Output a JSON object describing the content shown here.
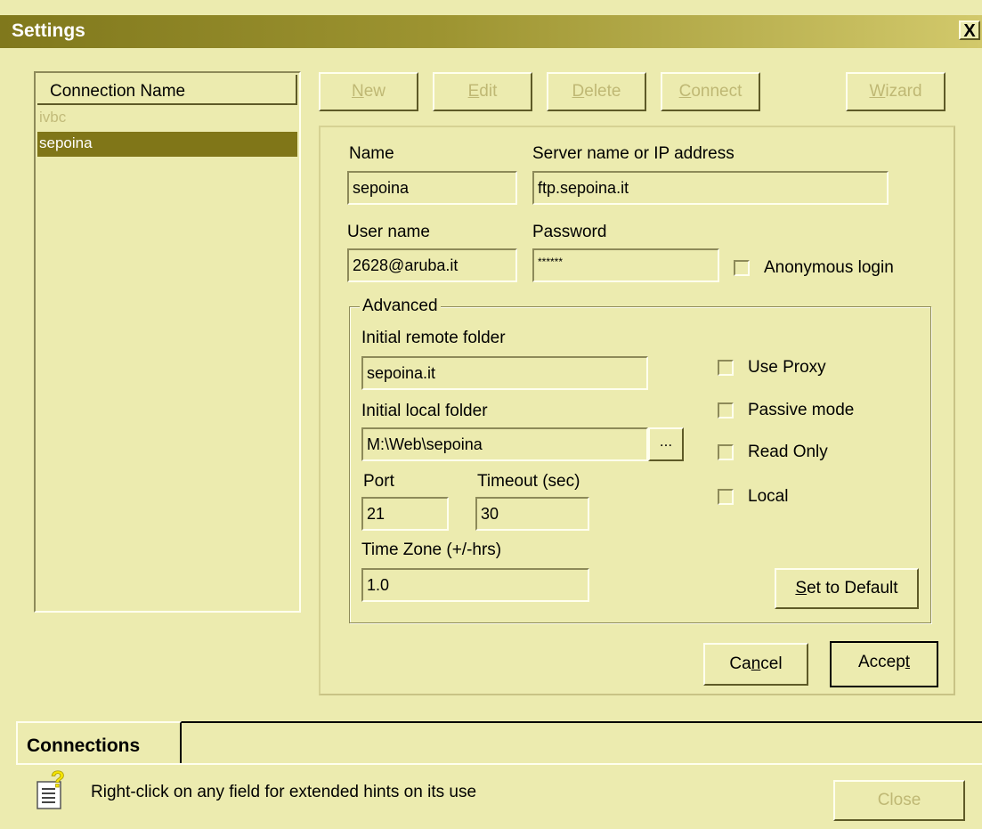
{
  "window": {
    "title": "Settings",
    "close_glyph": "X"
  },
  "connections_list": {
    "header": "Connection Name",
    "items": [
      {
        "label": "ivbc",
        "state": "disabled"
      },
      {
        "label": "sepoina",
        "state": "selected"
      }
    ]
  },
  "toolbar": {
    "new_label": "New",
    "new_mnemonic": "N",
    "new_rest": "ew",
    "edit_label": "Edit",
    "edit_mnemonic": "E",
    "edit_rest": "dit",
    "delete_label": "Delete",
    "delete_mnemonic": "D",
    "delete_rest": "elete",
    "connect_label": "Connect",
    "connect_mnemonic": "C",
    "connect_rest": "onnect",
    "wizard_label": "Wizard",
    "wizard_mnemonic": "W",
    "wizard_rest": "izard"
  },
  "form": {
    "name_label": "Name",
    "name_value": "sepoina",
    "server_label": "Server name or IP address",
    "server_value": "ftp.sepoina.it",
    "user_label": "User name",
    "user_value": "2628@aruba.it",
    "password_label": "Password",
    "password_value": "******",
    "anonymous_label": "Anonymous login"
  },
  "advanced": {
    "group_label": "Advanced",
    "remote_folder_label": "Initial remote folder",
    "remote_folder_value": "sepoina.it",
    "local_folder_label": "Initial local folder",
    "local_folder_value": "M:\\Web\\sepoina",
    "browse_label": "...",
    "port_label": "Port",
    "port_value": "21",
    "timeout_label": "Timeout (sec)",
    "timeout_value": "30",
    "timezone_label": "Time Zone (+/-hrs)",
    "timezone_value": "1.0",
    "use_proxy_label": "Use Proxy",
    "passive_mode_label": "Passive mode",
    "read_only_label": "Read Only",
    "local_label": "Local",
    "set_default_mnemonic": "S",
    "set_default_rest": "et to Default"
  },
  "actions": {
    "cancel_pre": "Ca",
    "cancel_mnemonic": "n",
    "cancel_post": "cel",
    "accept_pre": "Accep",
    "accept_mnemonic": "t",
    "accept_post": ""
  },
  "footer": {
    "tab_label": "Connections",
    "hint_text": "Right-click on any field for extended hints on its use",
    "close_label": "Close"
  },
  "colors": {
    "window_bg": "#ecebaf",
    "title_gradient_start": "#80781c",
    "selection_bg": "#807618",
    "disabled_text": "#bfb874"
  },
  "icons": [
    "close-icon",
    "checkbox-icon",
    "hint-icon"
  ]
}
